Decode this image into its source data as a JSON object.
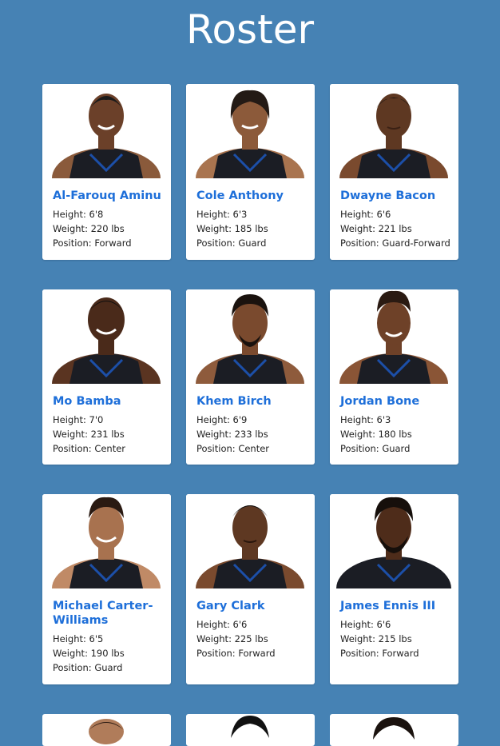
{
  "page": {
    "title": "Roster"
  },
  "labels": {
    "height": "Height:",
    "weight": "Weight:",
    "position": "Position:"
  },
  "colors": {
    "background": "#4682b4",
    "card": "#ffffff",
    "player_name": "#1e6fd9",
    "jersey": "#1b1d24",
    "jersey_trim": "#1c4fa8"
  },
  "players": [
    {
      "name": "Al-Farouq Aminu",
      "height": "6'8",
      "weight": "220 lbs",
      "position": "Forward"
    },
    {
      "name": "Cole Anthony",
      "height": "6'3",
      "weight": "185 lbs",
      "position": "Guard"
    },
    {
      "name": "Dwayne Bacon",
      "height": "6'6",
      "weight": "221 lbs",
      "position": "Guard-Forward"
    },
    {
      "name": "Mo Bamba",
      "height": "7'0",
      "weight": "231 lbs",
      "position": "Center"
    },
    {
      "name": "Khem Birch",
      "height": "6'9",
      "weight": "233 lbs",
      "position": "Center"
    },
    {
      "name": "Jordan Bone",
      "height": "6'3",
      "weight": "180 lbs",
      "position": "Guard"
    },
    {
      "name": "Michael Carter-Williams",
      "height": "6'5",
      "weight": "190 lbs",
      "position": "Guard"
    },
    {
      "name": "Gary Clark",
      "height": "6'6",
      "weight": "225 lbs",
      "position": "Forward"
    },
    {
      "name": "James Ennis III",
      "height": "6'6",
      "weight": "215 lbs",
      "position": "Forward"
    }
  ]
}
